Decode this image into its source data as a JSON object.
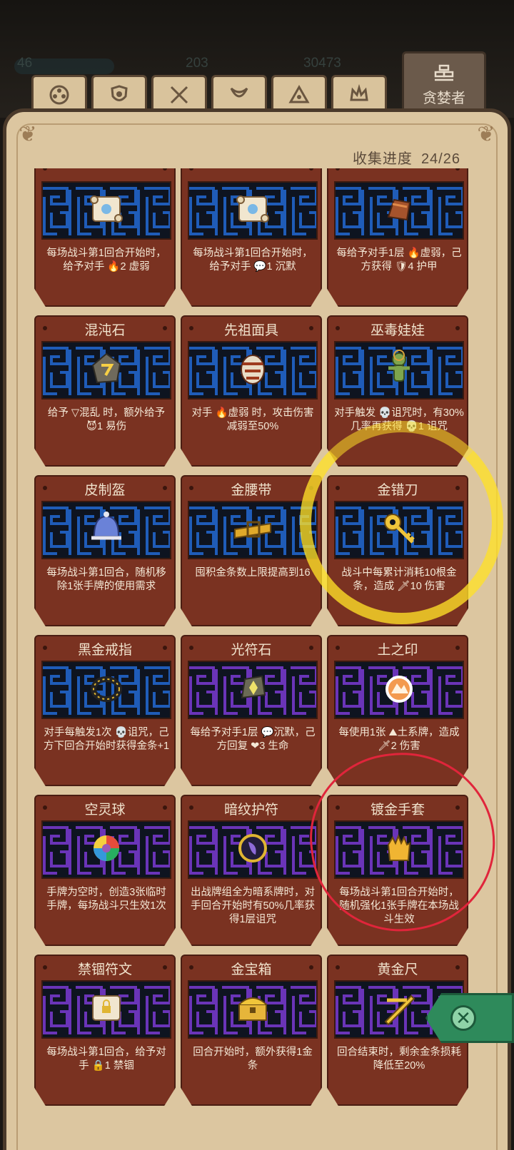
{
  "header": {
    "stats": [
      "46",
      "203",
      "30473"
    ],
    "active_tab_label": "贪婪者",
    "tabs": [
      {
        "icon": "flower-emblem-icon"
      },
      {
        "icon": "shield-emblem-icon"
      },
      {
        "icon": "crossed-blades-icon"
      },
      {
        "icon": "horn-emblem-icon"
      },
      {
        "icon": "triangle-emblem-icon"
      },
      {
        "icon": "crown-emblem-icon"
      }
    ]
  },
  "collection": {
    "progress_label": "收集进度",
    "progress_value": "24/26"
  },
  "cards": [
    {
      "title": "",
      "desc": "每场战斗第1回合开始时，给予对手 🔥2 虚弱",
      "maze": "blue",
      "icon": "scroll-icon"
    },
    {
      "title": "",
      "desc": "每场战斗第1回合开始时，给予对手 💬1 沉默",
      "maze": "blue",
      "icon": "scroll-icon"
    },
    {
      "title": "",
      "desc": "每给予对手1层 🔥虚弱，己方获得 🛡4 护甲",
      "maze": "blue",
      "icon": "bracer-icon"
    },
    {
      "title": "混沌石",
      "desc": "给予 ▽混乱 时，额外给予 😈1 易伤",
      "maze": "blue",
      "icon": "chaos-stone-icon"
    },
    {
      "title": "先祖面具",
      "desc": "对手 🔥虚弱 时，攻击伤害减弱至50%",
      "maze": "blue",
      "icon": "mask-icon"
    },
    {
      "title": "巫毒娃娃",
      "desc": "对手触发 💀诅咒时，有30%几率再获得 💀1 诅咒",
      "maze": "blue",
      "icon": "voodoo-doll-icon"
    },
    {
      "title": "皮制盔",
      "desc": "每场战斗第1回合，随机移除1张手牌的使用需求",
      "maze": "blue",
      "icon": "helmet-icon"
    },
    {
      "title": "金腰带",
      "desc": "囤积金条数上限提高到16",
      "maze": "blue",
      "icon": "belt-icon"
    },
    {
      "title": "金错刀",
      "desc": "战斗中每累计消耗10根金条，造成 🗡10 伤害",
      "maze": "blue",
      "icon": "golden-key-icon"
    },
    {
      "title": "黑金戒指",
      "desc": "对手每触发1次 💀诅咒，己方下回合开始时获得金条+1",
      "maze": "blue",
      "icon": "ring-icon"
    },
    {
      "title": "光符石",
      "desc": "每给予对手1层 💬沉默，己方回复 ❤3 生命",
      "maze": "purple",
      "icon": "rune-stone-icon"
    },
    {
      "title": "土之印",
      "desc": "每使用1张 ⛰土系牌，造成 🗡2 伤害",
      "maze": "purple",
      "icon": "earth-seal-icon"
    },
    {
      "title": "空灵球",
      "desc": "手牌为空时，创造3张临时手牌，每场战斗只生效1次",
      "maze": "purple",
      "icon": "rainbow-orb-icon"
    },
    {
      "title": "暗纹护符",
      "desc": "出战牌组全为暗系牌时，对手回合开始时有50%几率获得1层诅咒",
      "maze": "purple",
      "icon": "dark-amulet-icon"
    },
    {
      "title": "镀金手套",
      "desc": "每场战斗第1回合开始时，随机强化1张手牌在本场战斗生效",
      "maze": "purple",
      "icon": "gauntlet-icon"
    },
    {
      "title": "禁锢符文",
      "desc": "每场战斗第1回合，给予对手 🔒1 禁锢",
      "maze": "purple",
      "icon": "lock-scroll-icon"
    },
    {
      "title": "金宝箱",
      "desc": "回合开始时，额外获得1金条",
      "maze": "purple",
      "icon": "treasure-chest-icon"
    },
    {
      "title": "黄金尺",
      "desc": "回合结束时，剩余金条损耗降低至20%",
      "maze": "purple",
      "icon": "golden-ruler-icon"
    }
  ],
  "colors": {
    "card_bg": "#7a3221",
    "maze_blue": "#1f5cb8",
    "maze_purple": "#6a34b8",
    "parchment": "#dcc6a0",
    "highlight_yellow": "#ffe028",
    "highlight_red": "#e0253b",
    "close_green": "#2e8a5b"
  },
  "close_button": {
    "icon": "close-icon"
  }
}
